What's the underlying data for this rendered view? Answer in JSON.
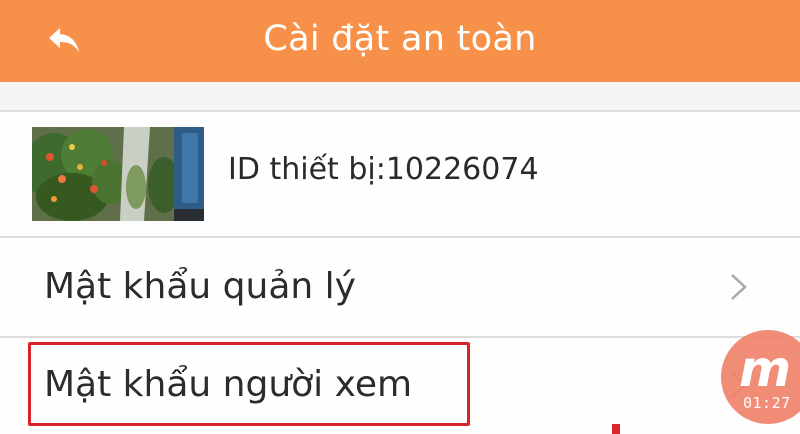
{
  "header": {
    "title": "Cài đặt an toàn",
    "back_icon": "back-arrow-icon",
    "background_color": "#f7914a"
  },
  "device": {
    "id_text": "ID thiết bị:10226074"
  },
  "settings": {
    "admin_password_label": "Mật khẩu quản lý",
    "viewer_password_label": "Mật khẩu người xem",
    "chevron_icon": "chevron-right-icon"
  },
  "annotation": {
    "highlight_color": "#d8252b"
  },
  "watermark": {
    "logo_text": "m",
    "time_text": "01:27"
  }
}
